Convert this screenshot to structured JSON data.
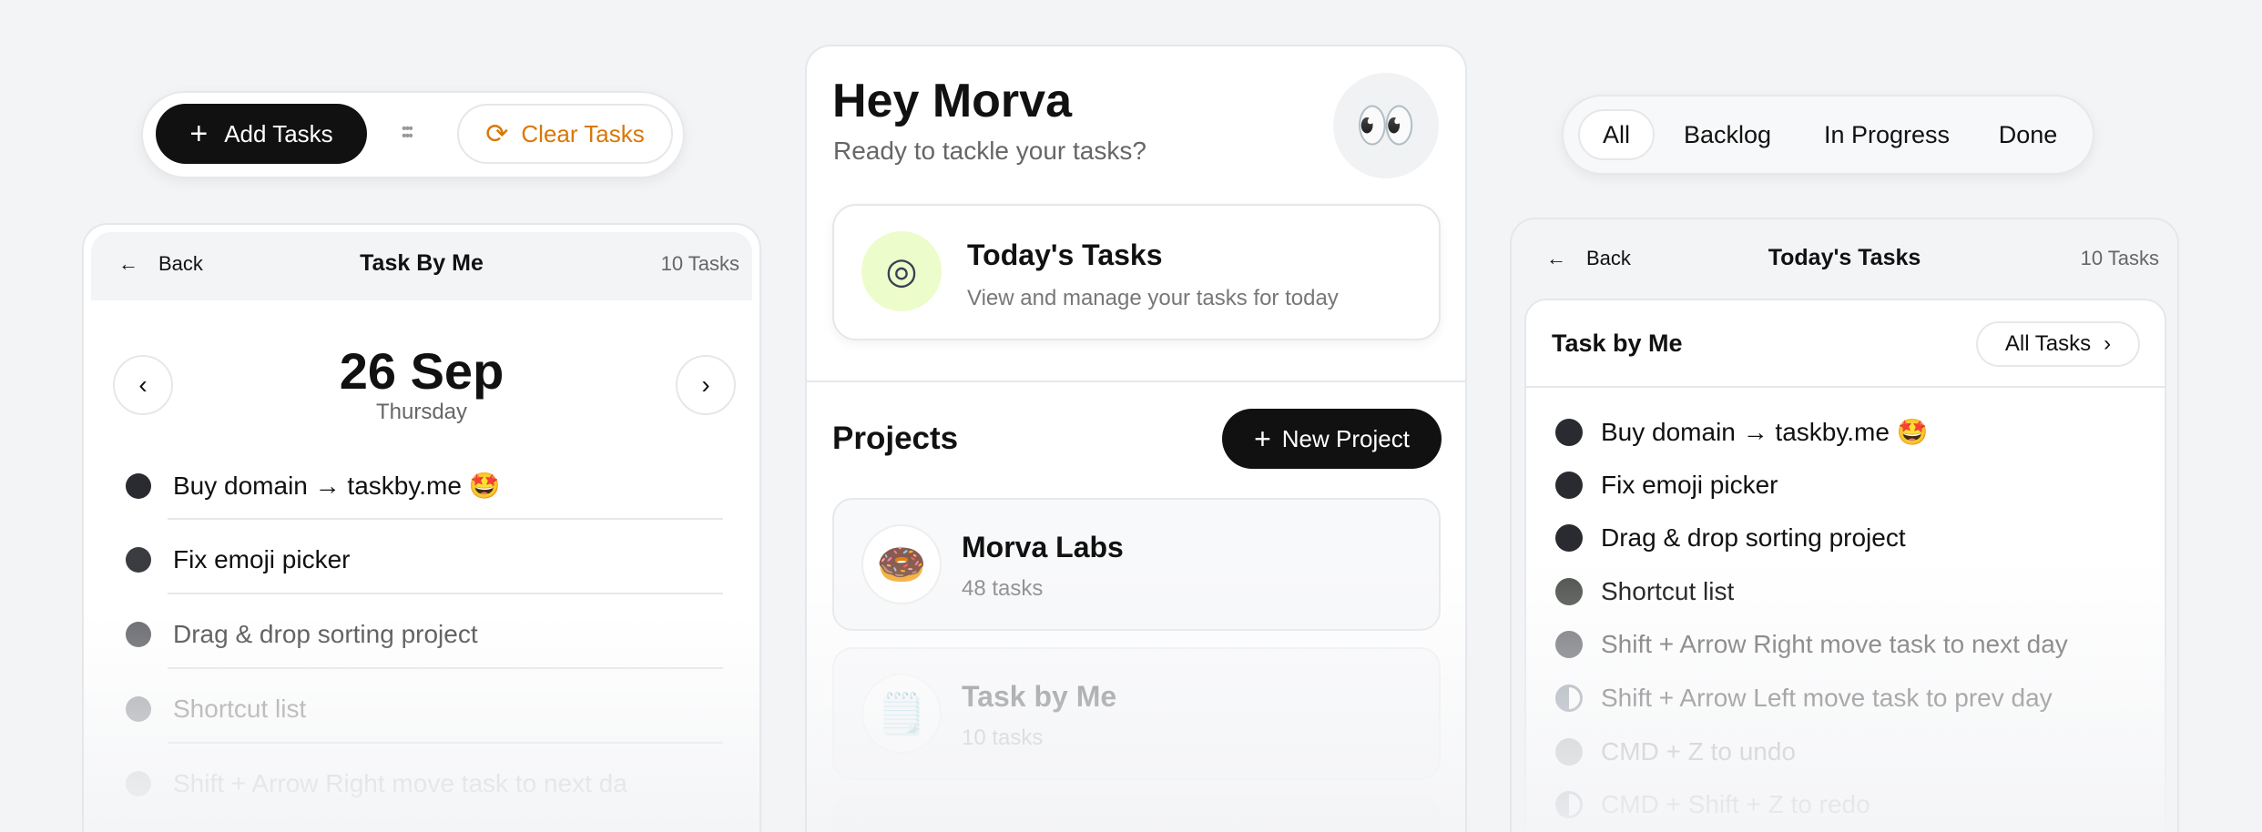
{
  "toolbar": {
    "add_label": "Add Tasks",
    "clear_label": "Clear Tasks",
    "accent": "#d97706"
  },
  "left_panel": {
    "back": "Back",
    "title": "Task By Me",
    "count": "10 Tasks",
    "date": "26 Sep",
    "weekday": "Thursday",
    "tasks": [
      {
        "label": "Buy domain → taskby.me 🤩",
        "color": "#2a2b30",
        "text": "#111"
      },
      {
        "label": "Fix emoji picker",
        "color": "#3a3c40",
        "text": "#111"
      },
      {
        "label": "Drag & drop sorting project",
        "color": "#6b6d72",
        "text": "#555"
      },
      {
        "label": "Shortcut list",
        "color": "#a3a5a9",
        "text": "#999"
      },
      {
        "label": "Shift + Arrow Right move task to next da",
        "color": "#cfd0d3",
        "text": "#c4c5c8"
      }
    ]
  },
  "home": {
    "greeting": "Hey Morva",
    "subtitle": "Ready to tackle your tasks?",
    "avatar": "👀",
    "today": {
      "title": "Today's Tasks",
      "desc": "View and manage your tasks for today",
      "icon": "target-play-icon",
      "icon_bg": "#ecfccb"
    },
    "projects_title": "Projects",
    "new_project": "New Project",
    "projects": [
      {
        "name": "Morva Labs",
        "count": "48 tasks",
        "emoji": "🍩"
      },
      {
        "name": "Task by Me",
        "count": "10 tasks",
        "emoji": "🗒️"
      }
    ]
  },
  "filters": {
    "items": [
      "All",
      "Backlog",
      "In Progress",
      "Done"
    ],
    "active": "All"
  },
  "right_panel": {
    "back": "Back",
    "title": "Today's Tasks",
    "count": "10 Tasks",
    "section": "Task by Me",
    "all_tasks": "All Tasks",
    "tasks": [
      {
        "label": "Buy domain → taskby.me 🤩",
        "color": "#2a2b30"
      },
      {
        "label": "Fix emoji picker",
        "color": "#2a2b30"
      },
      {
        "label": "Drag & drop sorting project",
        "color": "#2a2b30"
      },
      {
        "label": "Shortcut list",
        "color": "#4b4e4a"
      },
      {
        "label": "Shift + Arrow Right move task to next day",
        "color": "#6b6d72"
      },
      {
        "label": "Shift + Arrow Left move task to prev day",
        "color": "half"
      },
      {
        "label": "CMD + Z to undo",
        "color": "#b9bbbe"
      },
      {
        "label": "CMD + Shift + Z to redo",
        "color": "half"
      }
    ]
  }
}
